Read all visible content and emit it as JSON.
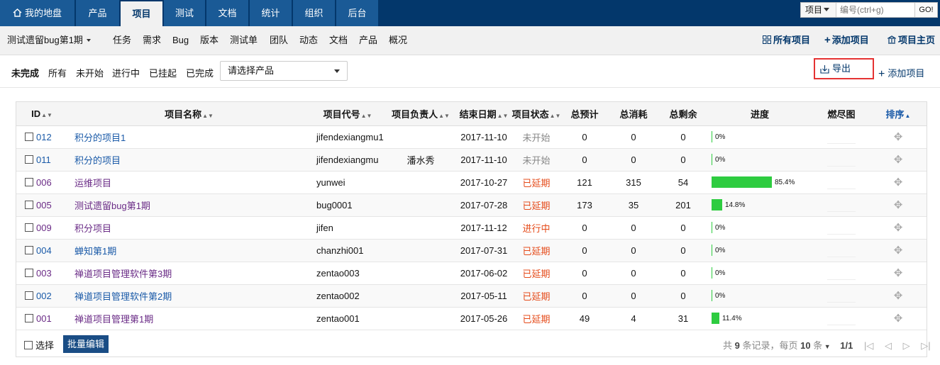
{
  "topnav": {
    "tabs": [
      {
        "label": "我的地盘",
        "icon": "home-icon"
      },
      {
        "label": "产品"
      },
      {
        "label": "项目",
        "active": true
      },
      {
        "label": "测试"
      },
      {
        "label": "文档"
      },
      {
        "label": "统计"
      },
      {
        "label": "组织"
      },
      {
        "label": "后台"
      }
    ],
    "search": {
      "scope": "项目",
      "placeholder": "编号(ctrl+g)",
      "go": "GO!"
    }
  },
  "subnav": {
    "current_project": "测试遗留bug第1期",
    "items": [
      "任务",
      "需求",
      "Bug",
      "版本",
      "测试单",
      "团队",
      "动态",
      "文档",
      "产品",
      "概况"
    ],
    "right": {
      "all_projects": "所有项目",
      "add_project": "添加项目",
      "project_home": "项目主页"
    }
  },
  "filters": {
    "status": [
      "未完成",
      "所有",
      "未开始",
      "进行中",
      "已挂起",
      "已完成"
    ],
    "active": "未完成",
    "product_select": "请选择产品",
    "export": "导出",
    "add_project": "添加项目"
  },
  "table": {
    "headers": {
      "id": "ID",
      "name": "项目名称",
      "code": "项目代号",
      "owner": "项目负责人",
      "end": "结束日期",
      "status": "项目状态",
      "estimate": "总预计",
      "consumed": "总消耗",
      "left": "总剩余",
      "progress": "进度",
      "burn": "燃尽图",
      "order": "排序"
    },
    "rows": [
      {
        "id": "012",
        "name": "积分的项目1",
        "code": "jifendexiangmu1",
        "owner": "",
        "end": "2017-11-10",
        "status": "未开始",
        "estimate": "0",
        "consumed": "0",
        "left": "0",
        "progress": 0,
        "progress_label": "0%"
      },
      {
        "id": "011",
        "name": "积分的项目",
        "code": "jifendexiangmu",
        "owner": "潘水秀",
        "end": "2017-11-10",
        "status": "未开始",
        "estimate": "0",
        "consumed": "0",
        "left": "0",
        "progress": 0,
        "progress_label": "0%"
      },
      {
        "id": "006",
        "name": "运维项目",
        "code": "yunwei",
        "owner": "",
        "end": "2017-10-27",
        "status": "已延期",
        "estimate": "121",
        "consumed": "315",
        "left": "54",
        "progress": 85.4,
        "progress_label": "85.4%"
      },
      {
        "id": "005",
        "name": "测试遗留bug第1期",
        "code": "bug0001",
        "owner": "",
        "end": "2017-07-28",
        "status": "已延期",
        "estimate": "173",
        "consumed": "35",
        "left": "201",
        "progress": 14.8,
        "progress_label": "14.8%"
      },
      {
        "id": "009",
        "name": "积分项目",
        "code": "jifen",
        "owner": "",
        "end": "2017-11-12",
        "status": "进行中",
        "estimate": "0",
        "consumed": "0",
        "left": "0",
        "progress": 0,
        "progress_label": "0%"
      },
      {
        "id": "004",
        "name": "蝉知第1期",
        "code": "chanzhi001",
        "owner": "",
        "end": "2017-07-31",
        "status": "已延期",
        "estimate": "0",
        "consumed": "0",
        "left": "0",
        "progress": 0,
        "progress_label": "0%"
      },
      {
        "id": "003",
        "name": "禅道项目管理软件第3期",
        "code": "zentao003",
        "owner": "",
        "end": "2017-06-02",
        "status": "已延期",
        "estimate": "0",
        "consumed": "0",
        "left": "0",
        "progress": 0,
        "progress_label": "0%"
      },
      {
        "id": "002",
        "name": "禅道项目管理软件第2期",
        "code": "zentao002",
        "owner": "",
        "end": "2017-05-11",
        "status": "已延期",
        "estimate": "0",
        "consumed": "0",
        "left": "0",
        "progress": 0,
        "progress_label": "0%"
      },
      {
        "id": "001",
        "name": "禅道项目管理第1期",
        "code": "zentao001",
        "owner": "",
        "end": "2017-05-26",
        "status": "已延期",
        "estimate": "49",
        "consumed": "4",
        "left": "31",
        "progress": 11.4,
        "progress_label": "11.4%"
      }
    ]
  },
  "footer": {
    "select_all": "选择",
    "batch_edit": "批量编辑",
    "pager": {
      "total_prefix": "共",
      "total": "9",
      "total_suffix": "条记录，每页",
      "per_page": "10",
      "per_page_suffix": "条",
      "page": "1/1"
    }
  }
}
